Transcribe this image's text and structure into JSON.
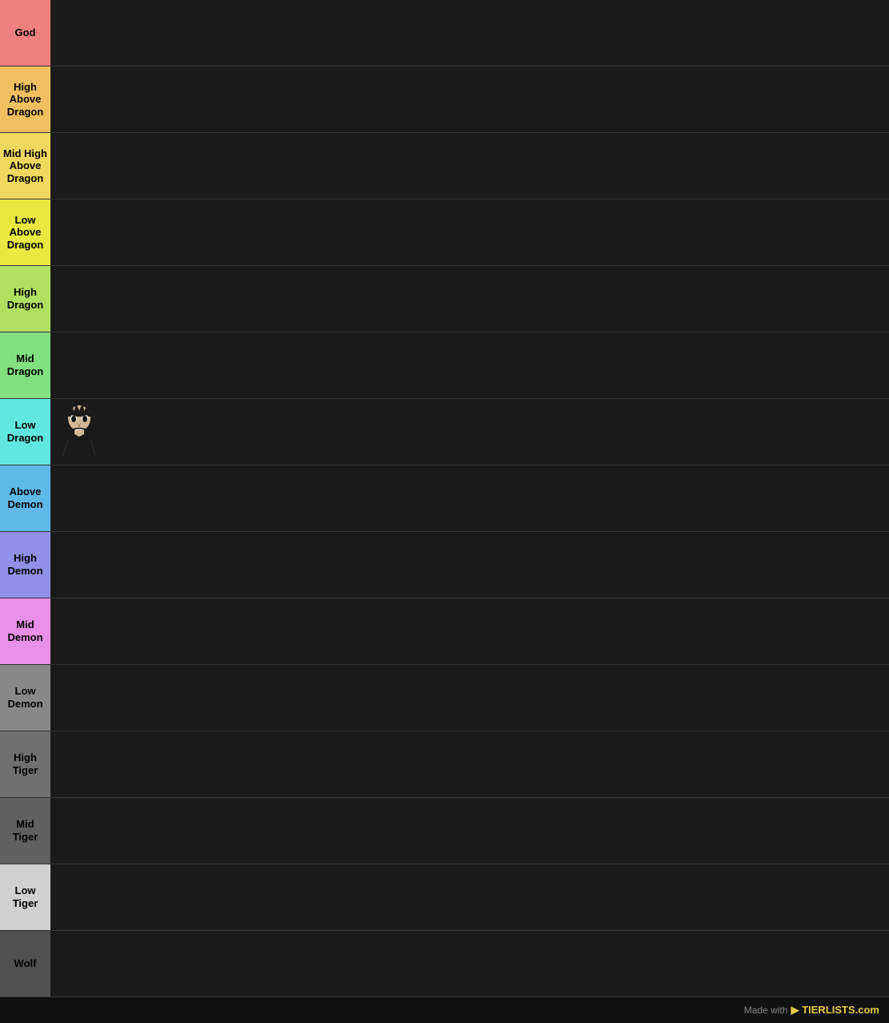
{
  "tiers": [
    {
      "id": "god",
      "label": "God",
      "color": "#f08080",
      "items": []
    },
    {
      "id": "high-above-dragon",
      "label": "High Above Dragon",
      "color": "#f0c060",
      "items": []
    },
    {
      "id": "mid-high-above-dragon",
      "label": "Mid High Above Dragon",
      "color": "#f0d860",
      "items": []
    },
    {
      "id": "low-above-dragon",
      "label": "Low Above Dragon",
      "color": "#e8e840",
      "items": []
    },
    {
      "id": "high-dragon",
      "label": "High Dragon",
      "color": "#b0e060",
      "items": []
    },
    {
      "id": "mid-dragon",
      "label": "Mid Dragon",
      "color": "#80e080",
      "items": []
    },
    {
      "id": "low-dragon",
      "label": "Low Dragon",
      "color": "#60e8e0",
      "items": [
        "character"
      ]
    },
    {
      "id": "above-demon",
      "label": "Above Demon",
      "color": "#60b8e8",
      "items": []
    },
    {
      "id": "high-demon",
      "label": "High Demon",
      "color": "#9090e8",
      "items": []
    },
    {
      "id": "mid-demon",
      "label": "Mid Demon",
      "color": "#e890e8",
      "items": []
    },
    {
      "id": "low-demon",
      "label": "Low Demon",
      "color": "#888888",
      "items": []
    },
    {
      "id": "high-tiger",
      "label": "High Tiger",
      "color": "#707070",
      "items": []
    },
    {
      "id": "mid-tiger",
      "label": "Mid Tiger",
      "color": "#606060",
      "items": []
    },
    {
      "id": "low-tiger",
      "label": "Low Tiger",
      "color": "#d0d0d0",
      "items": []
    },
    {
      "id": "wolf",
      "label": "Wolf",
      "color": "#505050",
      "items": []
    }
  ],
  "footer": {
    "made_with": "Made with",
    "brand": "TIERLISTS.com"
  }
}
